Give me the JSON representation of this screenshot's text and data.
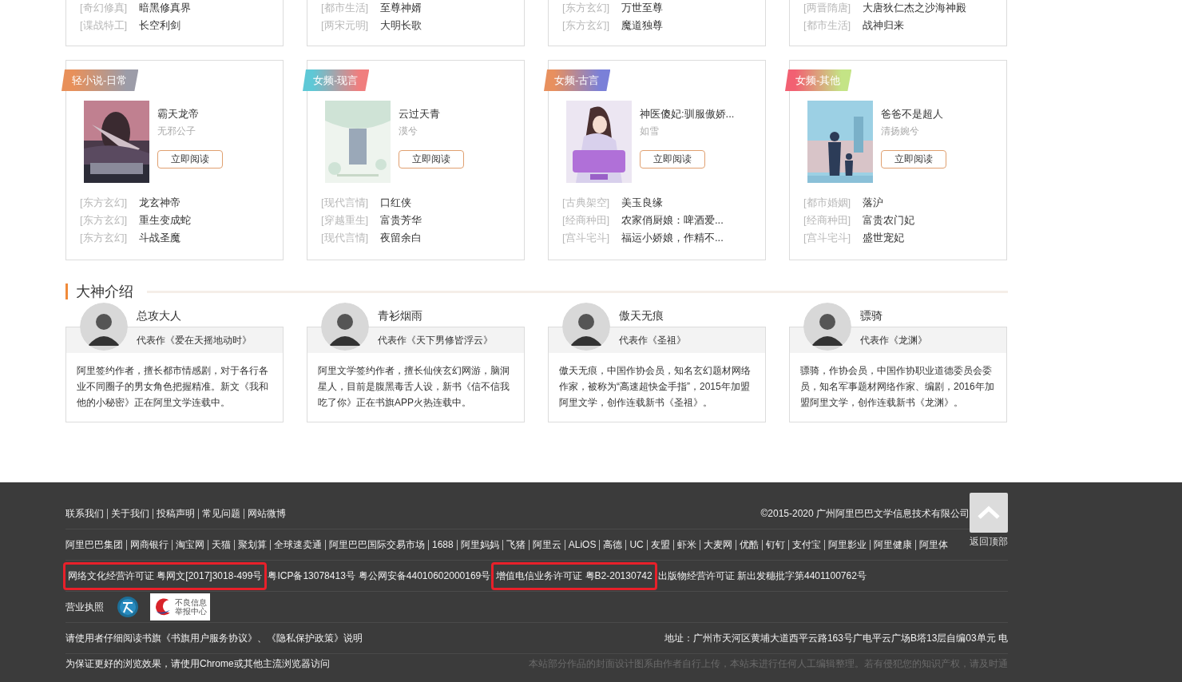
{
  "top_cards": [
    {
      "rows": [
        {
          "tag": "[奇幻修真]",
          "title": "暗黑修真界"
        },
        {
          "tag": "[谍战特工]",
          "title": "长空利剑"
        }
      ]
    },
    {
      "rows": [
        {
          "tag": "[都市生活]",
          "title": "至尊神婿"
        },
        {
          "tag": "[两宋元明]",
          "title": "大明长歌"
        }
      ]
    },
    {
      "rows": [
        {
          "tag": "[东方玄幻]",
          "title": "万世至尊"
        },
        {
          "tag": "[东方玄幻]",
          "title": "魔道独尊"
        }
      ]
    },
    {
      "rows": [
        {
          "tag": "[两晋隋唐]",
          "title": "大唐狄仁杰之沙海神殿"
        },
        {
          "tag": "[都市生活]",
          "title": "战神归来"
        }
      ]
    }
  ],
  "genre_cards": [
    {
      "label": "轻小说-日常",
      "gradient": [
        {
          "color": "#e8905a"
        },
        {
          "color": "#9c9ca8"
        }
      ],
      "book": {
        "title": "霸天龙帝",
        "author": "无邪公子",
        "button": "立即阅读"
      },
      "rows": [
        {
          "tag": "[东方玄幻]",
          "title": "龙玄神帝"
        },
        {
          "tag": "[东方玄幻]",
          "title": "重生变成蛇"
        },
        {
          "tag": "[东方玄幻]",
          "title": "斗战圣魔"
        }
      ]
    },
    {
      "label": "女频-现言",
      "gradient": [
        {
          "color": "#5ec8d6"
        },
        {
          "color": "#f07e7e"
        }
      ],
      "book": {
        "title": "云过天青",
        "author": "漠兮",
        "button": "立即阅读"
      },
      "rows": [
        {
          "tag": "[现代言情]",
          "title": "口红侠"
        },
        {
          "tag": "[穿越重生]",
          "title": "富贵芳华"
        },
        {
          "tag": "[现代言情]",
          "title": "夜留余白"
        }
      ]
    },
    {
      "label": "女频-古言",
      "gradient": [
        {
          "color": "#e8905e"
        },
        {
          "color": "#7a80d8"
        }
      ],
      "book": {
        "title": "神医傻妃:驯服傲娇...",
        "author": "如雪",
        "button": "立即阅读"
      },
      "rows": [
        {
          "tag": "[古典架空]",
          "title": "美玉良缘"
        },
        {
          "tag": "[经商种田]",
          "title": "农家俏厨娘：啤酒爱..."
        },
        {
          "tag": "[宫斗宅斗]",
          "title": "福运小娇娘，作精不..."
        }
      ]
    },
    {
      "label": "女频-其他",
      "gradient": [
        {
          "color": "#f26072"
        },
        {
          "color": "#c4e486"
        }
      ],
      "book": {
        "title": "爸爸不是超人",
        "author": "清扬婉兮",
        "button": "立即阅读"
      },
      "rows": [
        {
          "tag": "[都市婚姻]",
          "title": "落沪"
        },
        {
          "tag": "[经商种田]",
          "title": "富贵农门妃"
        },
        {
          "tag": "[宫斗宅斗]",
          "title": "盛世宠妃"
        }
      ]
    }
  ],
  "authors_section": {
    "title": "大神介绍",
    "authors": [
      {
        "name": "总攻大人",
        "work": "代表作《爱在天摇地动时》",
        "bio": "阿里签约作者，擅长都市情感剧，对于各行各业不同圈子的男女角色把握精准。新文《我和他的小秘密》正在阿里文学连载中。"
      },
      {
        "name": "青衫烟雨",
        "work": "代表作《天下男修皆浮云》",
        "bio": "阿里文学签约作者，擅长仙侠玄幻网游，脑洞星人，目前是腹黑毒舌人设，新书《信不信我吃了你》正在书旗APP火热连载中。"
      },
      {
        "name": "傲天无痕",
        "work": "代表作《圣祖》",
        "bio": "傲天无痕，中国作协会员，知名玄幻题材网络作家，被称为“高速超快金手指”，2015年加盟阿里文学，创作连载新书《圣祖》。"
      },
      {
        "name": "骠骑",
        "work": "代表作《龙渊》",
        "bio": "骠骑，作协会员，中国作协职业道德委员会委员，知名军事题材网络作家、编剧，2016年加盟阿里文学，创作连载新书《龙渊》。"
      }
    ]
  },
  "footer": {
    "links": [
      "联系我们",
      "关于我们",
      "投稿声明",
      "常见问题",
      "网站微博"
    ],
    "copyright": "©2015-2020 广州阿里巴巴文学信息技术有限公司",
    "partners": [
      "阿里巴巴集团",
      "网商银行",
      "淘宝网",
      "天猫",
      "聚划算",
      "全球速卖通",
      "阿里巴巴国际交易市场",
      "1688",
      "阿里妈妈",
      "飞猪",
      "阿里云",
      "ALiOS",
      "高德",
      "UC",
      "友盟",
      "虾米",
      "大麦网",
      "优酷",
      "钉钉",
      "支付宝",
      "阿里影业",
      "阿里健康",
      "阿里体"
    ],
    "licenses": [
      {
        "text": "网络文化经营许可证 粤网文[2017]3018-499号",
        "highlighted": true
      },
      {
        "text": "粤ICP备13078413号",
        "highlighted": false
      },
      {
        "text": "粤公网安备44010602000169号",
        "highlighted": false
      },
      {
        "text": "增值电信业务许可证 粤B2-20130742",
        "highlighted": true
      },
      {
        "text": "出版物经营许可证 新出发穗批字第4401100762号",
        "highlighted": false
      }
    ],
    "business_license": "营业执照",
    "report_badge": [
      "不良信息",
      "举报中心"
    ],
    "agreement": "请使用者仔细阅读书旗《书旗用户服务协议》、《隐私保护政策》说明",
    "address": "地址：广州市天河区黄埔大道西平云路163号广电平云广场B塔13层自编03单元 电",
    "browser_note": "为保证更好的浏览效果，请使用Chrome或其他主流浏览器访问",
    "disclaimer": "本站部分作品的封面设计图系由作者自行上传，本站未进行任何人工编辑整理。若有侵犯您的知识产权，请及时通",
    "back_to_top": "返回顶部"
  }
}
